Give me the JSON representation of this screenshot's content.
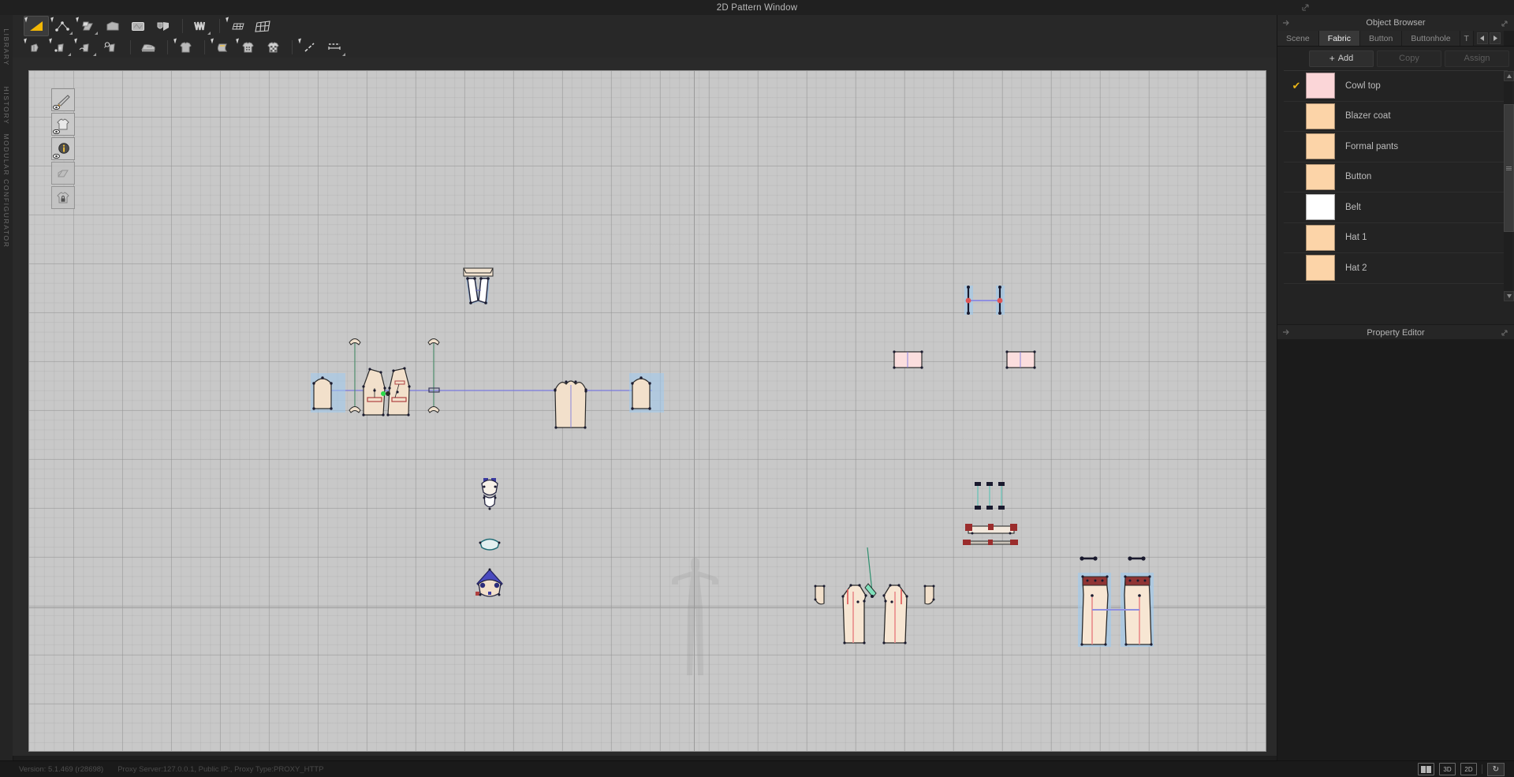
{
  "window": {
    "title": "2D Pattern Window",
    "expand_icon": "expand-icon"
  },
  "left_rail": {
    "tabs": [
      {
        "label": "LIBRARY",
        "name": "rail-tab-library"
      },
      {
        "label": "HISTORY",
        "name": "rail-tab-history"
      },
      {
        "label": "MODULAR CONFIGURATOR",
        "name": "rail-tab-modular-configurator"
      }
    ]
  },
  "toolbar_row1": {
    "tools": [
      {
        "name": "edit-pattern-tool",
        "icon": "triangle-select-icon",
        "selected": true
      },
      {
        "name": "edit-curve-point-tool",
        "icon": "curve-point-icon",
        "selected": false
      },
      {
        "name": "fold-unfold-tool",
        "icon": "fold-arrange-icon",
        "selected": false
      },
      {
        "name": "polygon-tool",
        "icon": "polygon-icon",
        "selected": false
      },
      {
        "name": "rectangle-tool",
        "icon": "rectangle-icon",
        "selected": false
      },
      {
        "name": "internal-polygon-tool",
        "icon": "internal-shape-icon",
        "selected": false
      },
      {
        "name": "pleat-tool",
        "icon": "pleat-icon",
        "selected": false
      },
      {
        "name": "grid-small-tool",
        "icon": "grid-small-icon",
        "selected": false
      },
      {
        "name": "grid-large-tool",
        "icon": "grid-large-icon",
        "selected": false
      }
    ]
  },
  "toolbar_row2": {
    "tools": [
      {
        "name": "sewing-segment-tool",
        "icon": "segment-sew-icon",
        "selected": false
      },
      {
        "name": "sewing-free-tool",
        "icon": "free-sew-icon",
        "selected": false
      },
      {
        "name": "sewing-curve-tool",
        "icon": "curve-sew-icon",
        "selected": false
      },
      {
        "name": "sewing-check-tool",
        "icon": "inspect-sew-icon",
        "selected": false
      },
      {
        "name": "iron-tool",
        "icon": "iron-icon",
        "selected": false
      },
      {
        "name": "garment-tool",
        "icon": "shirt-icon",
        "selected": false
      },
      {
        "name": "fabric-roll-tool",
        "icon": "fabric-roll-icon",
        "selected": false
      },
      {
        "name": "texture-tool",
        "icon": "shirt-texture-icon",
        "selected": false
      },
      {
        "name": "pattern-fill-tool",
        "icon": "shirt-checker-icon",
        "selected": false
      },
      {
        "name": "measure-line-tool",
        "icon": "measure-line-icon",
        "selected": false
      },
      {
        "name": "measure-dotted-tool",
        "icon": "measure-dotted-icon",
        "selected": false
      }
    ]
  },
  "canvas_palette": {
    "items": [
      {
        "name": "show-pen-tool",
        "icon": "pen-eye-icon"
      },
      {
        "name": "show-garment-tool",
        "icon": "shirt-eye-icon"
      },
      {
        "name": "show-info-tool",
        "icon": "info-eye-icon"
      },
      {
        "name": "show-fold-tool",
        "icon": "fold-icon"
      },
      {
        "name": "lock-garment-tool",
        "icon": "shirt-lock-icon"
      }
    ]
  },
  "object_browser": {
    "title": "Object Browser",
    "pin_icon": "pin-icon",
    "popout_icon": "popout-icon",
    "tabs": [
      {
        "label": "Scene",
        "active": false,
        "name": "tab-scene"
      },
      {
        "label": "Fabric",
        "active": true,
        "name": "tab-fabric"
      },
      {
        "label": "Button",
        "active": false,
        "name": "tab-button"
      },
      {
        "label": "Buttonhole",
        "active": false,
        "name": "tab-buttonhole"
      },
      {
        "label": "T",
        "active": false,
        "name": "tab-topstitch-clipped"
      }
    ],
    "tab_nav": {
      "prev_icon": "chevron-left-icon",
      "next_icon": "chevron-right-icon"
    },
    "actions": {
      "add_label": "Add",
      "add_plus": "+",
      "copy_label": "Copy",
      "copy_enabled": false,
      "assign_label": "Assign",
      "assign_enabled": false
    },
    "check_glyph": "✔",
    "fabrics": [
      {
        "name": "Cowl top",
        "color": "#fbd6d8",
        "checked": true
      },
      {
        "name": "Blazer coat",
        "color": "#fcd4a8",
        "checked": false
      },
      {
        "name": "Formal pants",
        "color": "#fcd4a8",
        "checked": false
      },
      {
        "name": "Button",
        "color": "#fcd4a8",
        "checked": false
      },
      {
        "name": "Belt",
        "color": "#ffffff",
        "checked": false
      },
      {
        "name": "Hat 1",
        "color": "#fcd4a8",
        "checked": false
      },
      {
        "name": "Hat 2",
        "color": "#fcd4a8",
        "checked": false
      }
    ],
    "scrollbar": {
      "up_icon": "scroll-up-icon",
      "down_icon": "scroll-down-icon",
      "grip_icon": "grip-icon"
    }
  },
  "property_editor": {
    "title": "Property Editor",
    "pin_icon": "pin-icon",
    "popout_icon": "popout-icon"
  },
  "status_bar": {
    "version": "Version: 5.1.469 (r28698)",
    "proxy": "Proxy Server:127.0.0.1, Public IP:, Proxy Type:PROXY_HTTP",
    "view_buttons": [
      {
        "label": "",
        "name": "view-split-button",
        "icon": "split-view-icon"
      },
      {
        "label": "3D",
        "name": "view-3d-button",
        "icon": "3d-icon"
      },
      {
        "label": "2D",
        "name": "view-2d-button",
        "icon": "2d-icon"
      }
    ],
    "refresh": {
      "label": "↻",
      "name": "refresh-button"
    }
  },
  "pattern_pieces": {
    "groups": [
      {
        "name": "hat-panels",
        "label": "Hat panels"
      },
      {
        "name": "cowl-top-bodice",
        "label": "Cowl top bodice"
      },
      {
        "name": "collar-pieces",
        "label": "Collar pieces"
      },
      {
        "name": "small-trims",
        "label": "Small trims"
      },
      {
        "name": "belt-strips",
        "label": "Belt strips"
      },
      {
        "name": "pocket-squares",
        "label": "Pocket squares"
      },
      {
        "name": "belt-loops",
        "label": "Belt loops"
      },
      {
        "name": "waistbands",
        "label": "Waistbands"
      },
      {
        "name": "pants-legs",
        "label": "Pants legs"
      },
      {
        "name": "pants-legs-selected",
        "label": "Pants legs selected"
      }
    ]
  }
}
